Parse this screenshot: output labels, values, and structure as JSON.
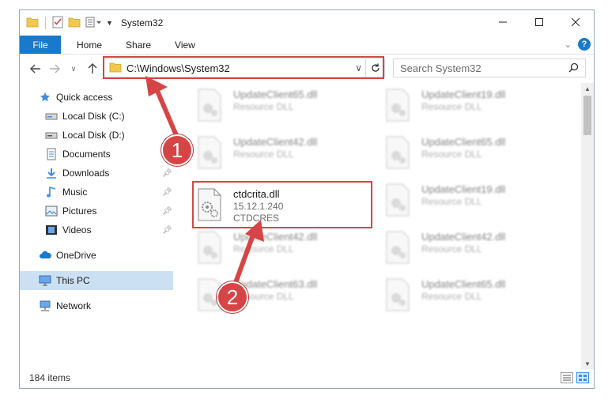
{
  "window": {
    "title": "System32"
  },
  "ribbon": {
    "tabs": [
      "File",
      "Home",
      "Share",
      "View"
    ]
  },
  "address_bar": {
    "path": "C:\\Windows\\System32"
  },
  "search": {
    "placeholder": "Search System32"
  },
  "sidebar": {
    "items": [
      {
        "label": "Quick access",
        "icon": "star-icon",
        "pinned": false
      },
      {
        "label": "Local Disk (C:)",
        "icon": "drive-icon",
        "pinned": false
      },
      {
        "label": "Local Disk (D:)",
        "icon": "drive-icon",
        "pinned": false
      },
      {
        "label": "Documents",
        "icon": "documents-icon",
        "pinned": false
      },
      {
        "label": "Downloads",
        "icon": "download-icon",
        "pinned": true
      },
      {
        "label": "Music",
        "icon": "music-icon",
        "pinned": true
      },
      {
        "label": "Pictures",
        "icon": "pictures-icon",
        "pinned": true
      },
      {
        "label": "Videos",
        "icon": "videos-icon",
        "pinned": true
      },
      {
        "label": "OneDrive",
        "icon": "cloud-icon",
        "pinned": false
      },
      {
        "label": "This PC",
        "icon": "computer-icon",
        "pinned": false,
        "selected": true
      },
      {
        "label": "Network",
        "icon": "network-icon",
        "pinned": false
      }
    ]
  },
  "files": [
    {
      "name": "UpdateClient65.dll",
      "desc": "Resource DLL",
      "faded": true
    },
    {
      "name": "UpdateClient19.dll",
      "desc": "Resource DLL",
      "faded": true
    },
    {
      "name": "UpdateClient42.dll",
      "desc": "Resource DLL",
      "faded": true
    },
    {
      "name": "UpdateClient65.dll",
      "desc": "Resource DLL",
      "faded": true
    },
    {
      "name": "ctdcrita.dll",
      "version": "15.12.1.240",
      "desc": "CTDCRES",
      "faded": false,
      "highlighted": true
    },
    {
      "name": "UpdateClient19.dll",
      "desc": "Resource DLL",
      "faded": true
    },
    {
      "name": "UpdateClient42.dll",
      "desc": "Resource DLL",
      "faded": true
    },
    {
      "name": "UpdateClient42.dll",
      "desc": "Resource DLL",
      "faded": true
    },
    {
      "name": "UpdateClient63.dll",
      "desc": "Resource DLL",
      "faded": true
    },
    {
      "name": "UpdateClient65.dll",
      "desc": "Resource DLL",
      "faded": true
    }
  ],
  "status": {
    "item_count": "184 items"
  },
  "annotations": {
    "step1": "1",
    "step2": "2",
    "highlight_color": "#d64545"
  },
  "colors": {
    "accent": "#1979ca",
    "selection": "#cce0f4"
  }
}
